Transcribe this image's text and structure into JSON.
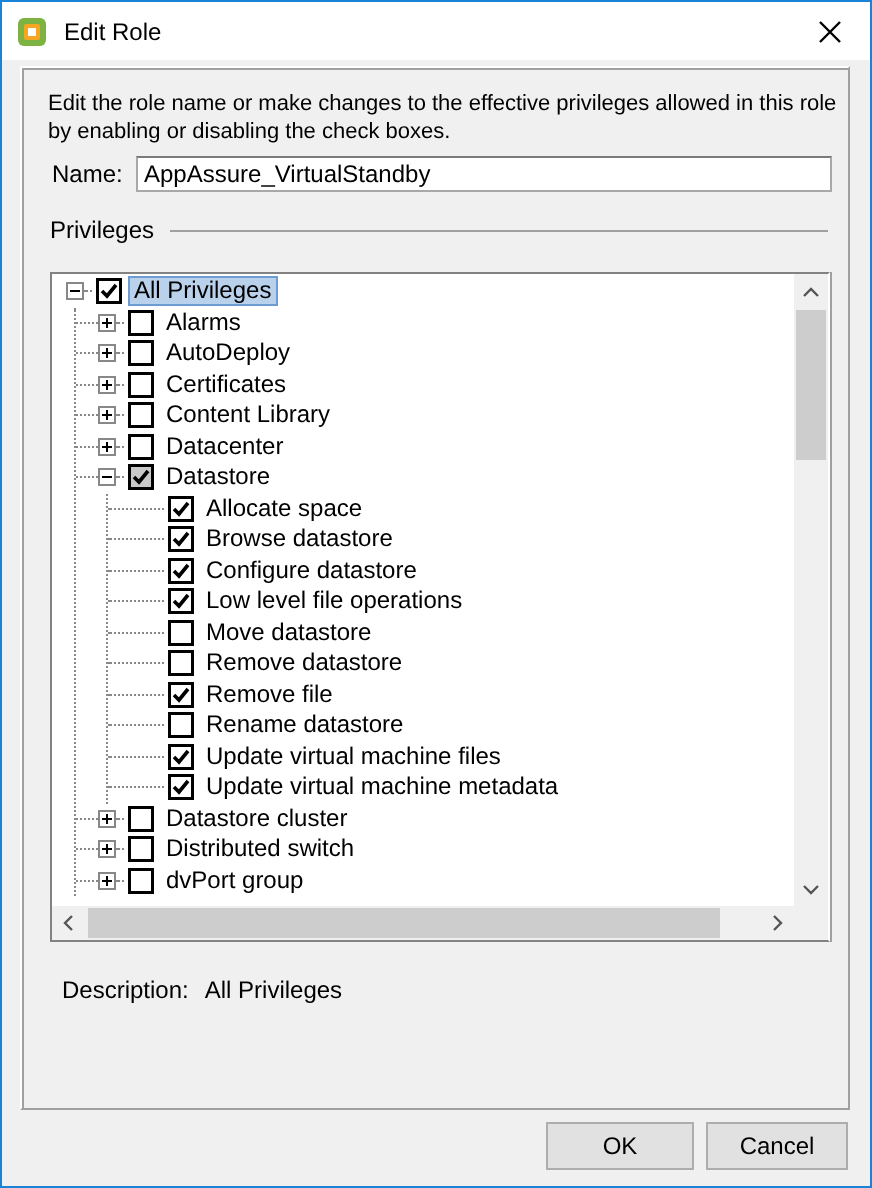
{
  "window": {
    "title": "Edit Role"
  },
  "intro": "Edit the role name or make changes to the effective privileges allowed in this role by enabling or disabling the check boxes.",
  "name_field": {
    "label": "Name:",
    "value": "AppAssure_VirtualStandby"
  },
  "privileges": {
    "heading": "Privileges",
    "tree": [
      {
        "label": "All Privileges",
        "checked": true,
        "partial": false,
        "expanded": true,
        "selected": true,
        "children": [
          {
            "label": "Alarms",
            "checked": false,
            "partial": false,
            "expanded": false,
            "selected": false
          },
          {
            "label": "AutoDeploy",
            "checked": false,
            "partial": false,
            "expanded": false,
            "selected": false
          },
          {
            "label": "Certificates",
            "checked": false,
            "partial": false,
            "expanded": false,
            "selected": false
          },
          {
            "label": "Content Library",
            "checked": false,
            "partial": false,
            "expanded": false,
            "selected": false
          },
          {
            "label": "Datacenter",
            "checked": false,
            "partial": false,
            "expanded": false,
            "selected": false
          },
          {
            "label": "Datastore",
            "checked": true,
            "partial": true,
            "expanded": true,
            "selected": false,
            "children": [
              {
                "label": "Allocate space",
                "checked": true,
                "partial": false,
                "selected": false
              },
              {
                "label": "Browse datastore",
                "checked": true,
                "partial": false,
                "selected": false
              },
              {
                "label": "Configure datastore",
                "checked": true,
                "partial": false,
                "selected": false
              },
              {
                "label": "Low level file operations",
                "checked": true,
                "partial": false,
                "selected": false
              },
              {
                "label": "Move datastore",
                "checked": false,
                "partial": false,
                "selected": false
              },
              {
                "label": "Remove datastore",
                "checked": false,
                "partial": false,
                "selected": false
              },
              {
                "label": "Remove file",
                "checked": true,
                "partial": false,
                "selected": false
              },
              {
                "label": "Rename datastore",
                "checked": false,
                "partial": false,
                "selected": false
              },
              {
                "label": "Update virtual machine files",
                "checked": true,
                "partial": false,
                "selected": false
              },
              {
                "label": "Update virtual machine metadata",
                "checked": true,
                "partial": false,
                "selected": false
              }
            ]
          },
          {
            "label": "Datastore cluster",
            "checked": false,
            "partial": false,
            "expanded": false,
            "selected": false
          },
          {
            "label": "Distributed switch",
            "checked": false,
            "partial": false,
            "expanded": false,
            "selected": false
          },
          {
            "label": "dvPort group",
            "checked": false,
            "partial": false,
            "expanded": false,
            "selected": false
          }
        ]
      }
    ]
  },
  "description": {
    "label": "Description:",
    "value": "All Privileges"
  },
  "buttons": [
    "OK",
    "Cancel"
  ]
}
